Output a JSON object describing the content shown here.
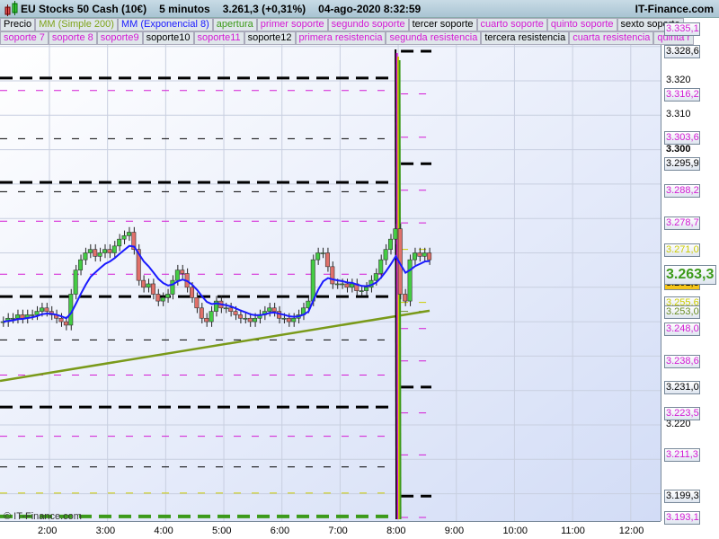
{
  "header": {
    "title": "EU Stocks 50 Cash (10€)",
    "interval": "5 minutos",
    "price": "3.261,3 (+0,31%)",
    "datetime": "04-ago-2020 8:32:59",
    "brand": "IT-Finance.com"
  },
  "legend_row1": [
    {
      "t": "Precio",
      "c": "#000"
    },
    {
      "t": "MM (Simple 200)",
      "c": "#7fa31a"
    },
    {
      "t": "MM (Exponencial 8)",
      "c": "#1a1aff"
    },
    {
      "t": "apertura",
      "c": "#3c9a1a"
    },
    {
      "t": "primer soporte",
      "c": "#d41ad4"
    },
    {
      "t": "segundo soporte",
      "c": "#d41ad4"
    },
    {
      "t": "tercer soporte",
      "c": "#000"
    },
    {
      "t": "cuarto soporte",
      "c": "#d41ad4"
    },
    {
      "t": "quinto soporte",
      "c": "#d41ad4"
    },
    {
      "t": "sexto soporte",
      "c": "#000"
    }
  ],
  "legend_row2": [
    {
      "t": "soporte 7",
      "c": "#d41ad4"
    },
    {
      "t": "soporte 8",
      "c": "#d41ad4"
    },
    {
      "t": "soporte9",
      "c": "#d41ad4"
    },
    {
      "t": "soporte10",
      "c": "#000"
    },
    {
      "t": "soporte11",
      "c": "#d41ad4"
    },
    {
      "t": "soporte12",
      "c": "#000"
    },
    {
      "t": "primera resistencia",
      "c": "#d41ad4"
    },
    {
      "t": "segunda resistencia",
      "c": "#d41ad4"
    },
    {
      "t": "tercera resistencia",
      "c": "#000"
    },
    {
      "t": "cuarta resistencia",
      "c": "#d41ad4"
    },
    {
      "t": "quinta r",
      "c": "#d41ad4"
    }
  ],
  "watermark": "© IT-Finance.com",
  "chart_data": {
    "type": "candlestick",
    "yticks": [
      "3.320",
      "3.310",
      "3.300",
      "3.220"
    ],
    "ytick_values": [
      3320,
      3310,
      3300,
      3220
    ],
    "xticks": [
      "2:00",
      "3:00",
      "4:00",
      "5:00",
      "6:00",
      "7:00",
      "8:00",
      "9:00",
      "10:00",
      "11:00",
      "12:00"
    ],
    "xtick_minutes": [
      120,
      180,
      240,
      300,
      360,
      420,
      480,
      540,
      600,
      660,
      720
    ],
    "start_minute": 70,
    "closes": [
      3250,
      3251,
      3251,
      3252,
      3251,
      3252,
      3252,
      3253,
      3254,
      3253,
      3252,
      3251,
      3250,
      3249,
      3258,
      3265,
      3268,
      3270,
      3271,
      3269,
      3270,
      3271,
      3270,
      3272,
      3274,
      3275,
      3276,
      3271,
      3262,
      3260,
      3261,
      3258,
      3256,
      3257,
      3258,
      3262,
      3265,
      3264,
      3260,
      3257,
      3254,
      3251,
      3250,
      3253,
      3256,
      3254,
      3254,
      3253,
      3252,
      3251,
      3251,
      3250,
      3251,
      3252,
      3253,
      3254,
      3253,
      3251,
      3251,
      3250,
      3251,
      3252,
      3254,
      3256,
      3268,
      3270,
      3270,
      3266,
      3261,
      3261,
      3261,
      3260,
      3261,
      3259,
      3259,
      3260,
      3262,
      3264,
      3268,
      3271,
      3274,
      3277,
      3258,
      3256,
      3268,
      3270,
      3269,
      3270,
      3268
    ],
    "sma200": [
      3232.8,
      3253.2
    ],
    "left_levels": [
      {
        "v": 3320.8,
        "c": "#000",
        "w": 3,
        "d": "14 8"
      },
      {
        "v": 3290.5,
        "c": "#000",
        "w": 3,
        "d": "14 8"
      },
      {
        "v": 3257.3,
        "c": "#000",
        "w": 3,
        "d": "14 8"
      },
      {
        "v": 3225.2,
        "c": "#000",
        "w": 3,
        "d": "14 8"
      },
      {
        "v": 3193.4,
        "c": "#3c9a1a",
        "w": 4,
        "d": "14 8"
      },
      {
        "v": 3317.2,
        "c": "#d41ad4",
        "w": 1,
        "d": "8 12"
      },
      {
        "v": 3303.2,
        "c": "#000",
        "w": 1,
        "d": "8 12"
      },
      {
        "v": 3287.8,
        "c": "#000",
        "w": 1,
        "d": "8 12"
      },
      {
        "v": 3279.2,
        "c": "#d41ad4",
        "w": 1,
        "d": "8 12"
      },
      {
        "v": 3263.8,
        "c": "#d41ad4",
        "w": 1,
        "d": "8 12"
      },
      {
        "v": 3244.7,
        "c": "#000",
        "w": 1,
        "d": "8 12"
      },
      {
        "v": 3234.5,
        "c": "#d41ad4",
        "w": 1,
        "d": "8 12"
      },
      {
        "v": 3216.7,
        "c": "#d41ad4",
        "w": 1,
        "d": "8 12"
      },
      {
        "v": 3207.8,
        "c": "#000",
        "w": 1,
        "d": "8 12"
      },
      {
        "v": 3200.2,
        "c": "#cccc00",
        "w": 1,
        "d": "8 12"
      }
    ],
    "right_levels": [
      {
        "label": "3.335,1",
        "v": 3335.1,
        "c": "#d41ad4",
        "w": 1
      },
      {
        "label": "3.328,6",
        "v": 3328.6,
        "c": "#000",
        "w": 3
      },
      {
        "label": "3.316,2",
        "v": 3316.2,
        "c": "#d41ad4",
        "w": 1
      },
      {
        "label": "3.303,6",
        "v": 3303.6,
        "c": "#d41ad4",
        "w": 1
      },
      {
        "label": "3.295,9",
        "v": 3295.9,
        "c": "#000",
        "w": 3
      },
      {
        "label": "3.288,2",
        "v": 3288.2,
        "c": "#d41ad4",
        "w": 1
      },
      {
        "label": "3.278,7",
        "v": 3278.7,
        "c": "#d41ad4",
        "w": 1
      },
      {
        "label": "3.271,0",
        "v": 3271.0,
        "c": "#cccc00",
        "w": 1
      },
      {
        "label": "3.255,6",
        "v": 3255.6,
        "c": "#cccc00",
        "w": 1
      },
      {
        "label": "3.253,0",
        "v": 3253.0,
        "c": "#6b8e23",
        "w": 1
      },
      {
        "label": "3.248,0",
        "v": 3248.0,
        "c": "#d41ad4",
        "w": 1
      },
      {
        "label": "3.238,6",
        "v": 3238.6,
        "c": "#d41ad4",
        "w": 1
      },
      {
        "label": "3.231,0",
        "v": 3231.0,
        "c": "#000",
        "w": 3
      },
      {
        "label": "3.223,5",
        "v": 3223.5,
        "c": "#d41ad4",
        "w": 1
      },
      {
        "label": "3.211,3",
        "v": 3211.3,
        "c": "#d41ad4",
        "w": 1
      },
      {
        "label": "3.199,3",
        "v": 3199.3,
        "c": "#000",
        "w": 3
      },
      {
        "label": "3.193,1",
        "v": 3193.1,
        "c": "#d41ad4",
        "w": 1
      }
    ],
    "last_price": {
      "label": "3.263,3",
      "v": 3263.3,
      "c": "#3c9a1a"
    },
    "current": {
      "label": "3.261,3",
      "v": 3261.3,
      "c": "#f5c518"
    }
  }
}
